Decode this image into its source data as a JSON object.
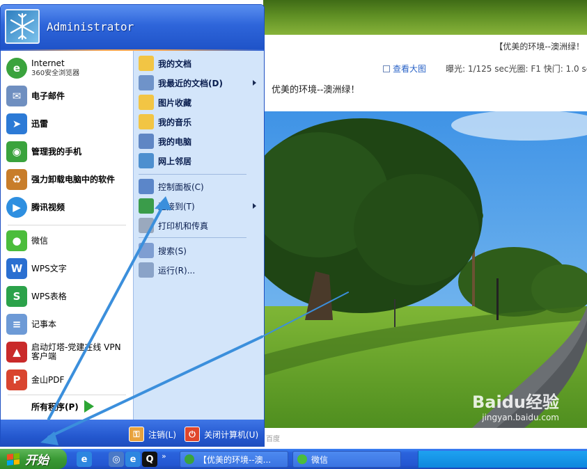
{
  "webpage": {
    "top_title": "【优美的环境--澳洲绿！",
    "view_large": "查看大图",
    "exif": "曝光: 1/125 sec光圈: F1 快门: 1.0 sec",
    "caption": "优美的环境--澳洲绿！",
    "bottom_text": "百度",
    "watermark": "Baidu经验",
    "watermark_url": "jingyan.baidu.com"
  },
  "start_menu": {
    "user_name": "Administrator",
    "left_items": [
      {
        "label": "Internet",
        "sublabel": "360安全浏览器",
        "icon": "browser-icon",
        "color": "#3aa33d"
      },
      {
        "label": "电子邮件",
        "icon": "email-icon",
        "color": "#6f8fc0"
      },
      {
        "label": "迅雷",
        "icon": "xunlei-icon",
        "color": "#2c7ad6"
      },
      {
        "label": "管理我的手机",
        "icon": "phone-manager-icon",
        "color": "#3aa33d"
      },
      {
        "label": "强力卸载电脑中的软件",
        "icon": "uninstall-icon",
        "color": "#c87d2a"
      },
      {
        "label": "腾讯视频",
        "icon": "tencent-video-icon",
        "color": "#2e8fe0"
      },
      {
        "label": "微信",
        "icon": "wechat-icon",
        "color": "#4bbd3b"
      },
      {
        "label": "WPS文字",
        "icon": "wps-writer-icon",
        "color": "#2a6fd1"
      },
      {
        "label": "WPS表格",
        "icon": "wps-sheet-icon",
        "color": "#2ba24a"
      },
      {
        "label": "记事本",
        "icon": "notepad-icon",
        "color": "#6d9ad6"
      },
      {
        "label": "启动灯塔-党建在线 VPN客户端",
        "icon": "lighthouse-icon",
        "color": "#c92a2a"
      },
      {
        "label": "金山PDF",
        "icon": "pdf-icon",
        "color": "#d9452f"
      }
    ],
    "all_programs": "所有程序(P)",
    "right_items": [
      {
        "label": "我的文档",
        "icon": "folder-icon",
        "color": "#f2c544"
      },
      {
        "label": "我最近的文档(D)",
        "icon": "recent-docs-icon",
        "color": "#6f93c9",
        "has_submenu": true
      },
      {
        "label": "图片收藏",
        "icon": "pictures-folder-icon",
        "color": "#f2c544"
      },
      {
        "label": "我的音乐",
        "icon": "music-folder-icon",
        "color": "#f2c544"
      },
      {
        "label": "我的电脑",
        "icon": "computer-icon",
        "color": "#5f86c4"
      },
      {
        "label": "网上邻居",
        "icon": "network-icon",
        "color": "#4d8fcf"
      },
      {
        "label": "控制面板(C)",
        "icon": "control-panel-icon",
        "color": "#5b86c9"
      },
      {
        "label": "连接到(T)",
        "icon": "connect-icon",
        "color": "#3a9c4a",
        "has_submenu": true
      },
      {
        "label": "打印机和传真",
        "icon": "printer-icon",
        "color": "#9aa9be"
      },
      {
        "label": "搜索(S)",
        "icon": "search-icon",
        "color": "#7f9ed2"
      },
      {
        "label": "运行(R)...",
        "icon": "run-icon",
        "color": "#8aa3c8"
      }
    ],
    "footer": {
      "logoff": "注销(L)",
      "shutdown": "关闭计算机(U)"
    }
  },
  "taskbar": {
    "start_label": "开始",
    "quick_launch": [
      "ie-icon",
      "browser-icon",
      "ie-icon",
      "qq-icon"
    ],
    "chevron": "»",
    "tasks": [
      {
        "label": "【优美的环境--澳...",
        "icon": "browser-icon",
        "color": "#3aa33d"
      },
      {
        "label": "微信",
        "icon": "wechat-icon",
        "color": "#4bbd3b"
      }
    ]
  },
  "colors": {
    "start_green": "#3a9a35",
    "menu_blue": "#2458cf",
    "right_col": "#d3e5fa",
    "annotation_arrow": "#3b8fdc"
  }
}
